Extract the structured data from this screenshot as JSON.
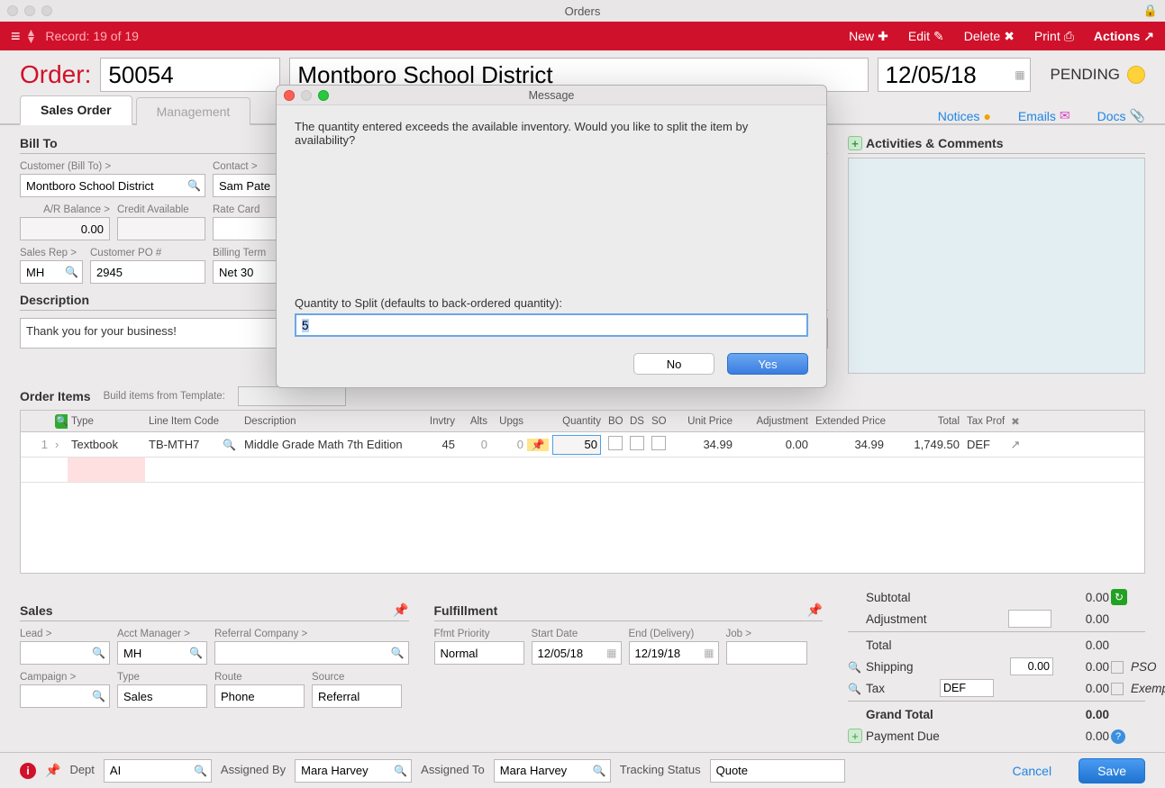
{
  "window_title": "Orders",
  "record": "Record: 19 of 19",
  "toolbar": {
    "new": "New",
    "edit": "Edit",
    "delete": "Delete",
    "print": "Print",
    "actions": "Actions"
  },
  "order": {
    "label": "Order:",
    "id": "50054",
    "customer": "Montboro School District",
    "date": "12/05/18",
    "status": "PENDING"
  },
  "tabs": {
    "sales": "Sales Order",
    "management": "Management"
  },
  "links": {
    "notices": "Notices",
    "emails": "Emails",
    "docs": "Docs"
  },
  "billto": {
    "heading": "Bill To",
    "customer_label": "Customer (Bill To) >",
    "customer": "Montboro School District",
    "contact_label": "Contact >",
    "contact": "Sam Pate",
    "ar_label": "A/R Balance >",
    "ar": "0.00",
    "credit_label": "Credit Available",
    "credit": "",
    "rate_label": "Rate Card",
    "rate": "",
    "rep_label": "Sales Rep >",
    "rep": "MH",
    "po_label": "Customer PO #",
    "po": "2945",
    "terms_label": "Billing Term",
    "terms": "Net 30"
  },
  "description": {
    "heading": "Description",
    "text": "Thank you for your business!"
  },
  "items": {
    "heading": "Order Items",
    "build_label": "Build items from Template:",
    "cols": {
      "type": "Type",
      "code": "Line Item Code",
      "desc": "Description",
      "invtry": "Invtry",
      "alts": "Alts",
      "upgs": "Upgs",
      "qty": "Quantity",
      "bo": "BO",
      "ds": "DS",
      "so": "SO",
      "unit": "Unit Price",
      "adj": "Adjustment",
      "ext": "Extended Price",
      "total": "Total",
      "tax": "Tax Profile"
    },
    "row": {
      "num": "1",
      "type": "Textbook",
      "code": "TB-MTH7",
      "desc": "Middle Grade Math 7th Edition",
      "invtry": "45",
      "alts": "0",
      "upgs": "0",
      "qty": "50",
      "unit": "34.99",
      "adj": "0.00",
      "ext": "34.99",
      "total": "1,749.50",
      "tax": "DEF"
    }
  },
  "sales": {
    "heading": "Sales",
    "lead_label": "Lead >",
    "lead": "",
    "amgr_label": "Acct Manager >",
    "amgr": "MH",
    "refco_label": "Referral Company >",
    "refco": "",
    "camp_label": "Campaign >",
    "camp": "",
    "type_label": "Type",
    "type": "Sales",
    "route_label": "Route",
    "route": "Phone",
    "source_label": "Source",
    "source": "Referral"
  },
  "fulfillment": {
    "heading": "Fulfillment",
    "prio_label": "Ffmt Priority",
    "prio": "Normal",
    "start_label": "Start Date",
    "start": "12/05/18",
    "end_label": "End (Delivery)",
    "end": "12/19/18",
    "job_label": "Job >",
    "job": ""
  },
  "activity": {
    "heading": "Activities & Comments"
  },
  "totals": {
    "subtotal_l": "Subtotal",
    "subtotal": "0.00",
    "adj_l": "Adjustment",
    "adj": "0.00",
    "total_l": "Total",
    "total": "0.00",
    "ship_l": "Shipping",
    "ship1": "0.00",
    "ship2": "0.00",
    "pso": "PSO",
    "tax_l": "Tax",
    "tax_code": "DEF",
    "tax": "0.00",
    "exempt": "Exempt",
    "grand_l": "Grand Total",
    "grand": "0.00",
    "due_l": "Payment Due",
    "due": "0.00"
  },
  "footer": {
    "dept_l": "Dept",
    "dept": "AI",
    "aby_l": "Assigned By",
    "aby": "Mara Harvey",
    "ato_l": "Assigned To",
    "ato": "Mara Harvey",
    "track_l": "Tracking Status",
    "track": "Quote",
    "cancel": "Cancel",
    "save": "Save"
  },
  "dialog": {
    "title": "Message",
    "text": "The quantity entered exceeds the available inventory. Would you like to split the item by availability?",
    "qty_label": "Quantity to Split (defaults to back-ordered quantity):",
    "qty": "5",
    "no": "No",
    "yes": "Yes"
  }
}
